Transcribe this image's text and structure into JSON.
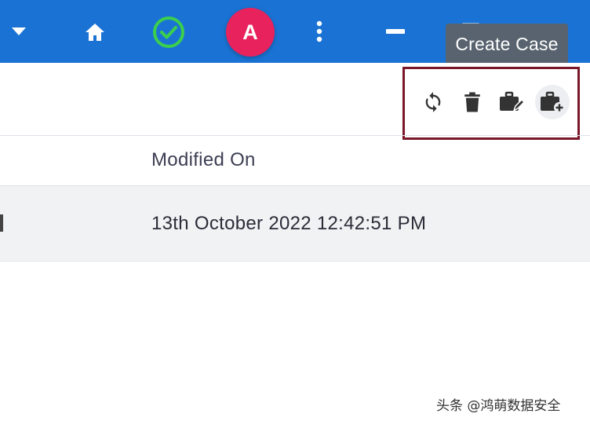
{
  "titlebar": {
    "avatar_letter": "A",
    "icons": {
      "dropdown": "caret-down-icon",
      "home": "home-icon",
      "status": "check-circle-icon",
      "more": "more-vert-icon",
      "minimize": "minimize-icon",
      "maximize": "maximize-icon",
      "close": "close-icon"
    },
    "colors": {
      "bar": "#1a73d4",
      "avatar": "#e8225c",
      "status": "#3ccf4e"
    }
  },
  "tooltip": {
    "text": "Create Case"
  },
  "toolbar": {
    "actions": [
      {
        "icon": "refresh-icon"
      },
      {
        "icon": "trash-icon"
      },
      {
        "icon": "edit-case-icon"
      },
      {
        "icon": "create-case-icon"
      }
    ],
    "highlight_color": "#7a1728"
  },
  "table": {
    "columns": [
      "Modified On"
    ],
    "rows": [
      {
        "modified_on": "13th October 2022 12:42:51 PM"
      }
    ]
  },
  "watermark": "头条 @鸿萌数据安全"
}
